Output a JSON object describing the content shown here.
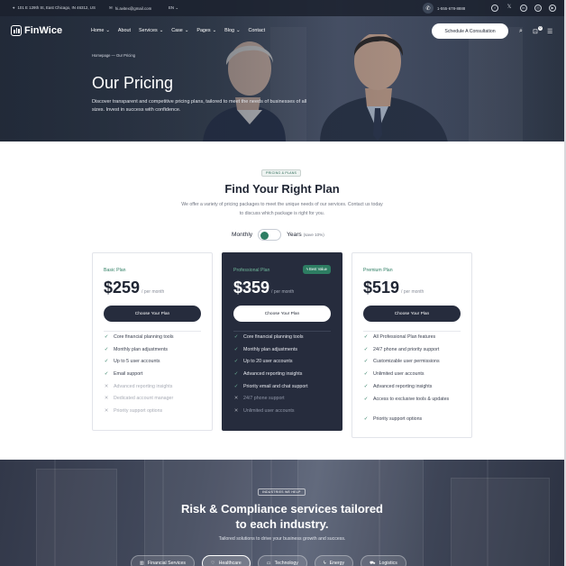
{
  "topbar": {
    "address": "101 E 129th St, East Chicago, IN 46312, US",
    "email": "hi.avitex@gmail.com",
    "language": "EN",
    "phone": "1-555-678-8888"
  },
  "nav": {
    "logo": "FinWice",
    "items": [
      {
        "label": "Home",
        "dropdown": true
      },
      {
        "label": "About",
        "dropdown": false
      },
      {
        "label": "Services",
        "dropdown": true
      },
      {
        "label": "Case",
        "dropdown": true
      },
      {
        "label": "Pages",
        "dropdown": true
      },
      {
        "label": "Blog",
        "dropdown": true
      },
      {
        "label": "Contact",
        "dropdown": false
      }
    ],
    "cta": "Schedule A Consultation",
    "cart_count": "0"
  },
  "hero": {
    "breadcrumb_home": "Homepage",
    "breadcrumb_current": "Our Pricing",
    "title": "Our Pricing",
    "subtitle": "Discover transparent and competitive pricing plans, tailored to meet the needs of businesses of all sizes. Invest in success with confidence."
  },
  "pricing": {
    "tag": "PRICING & PLANS",
    "title": "Find Your Right Plan",
    "description": "We offer a variety of pricing packages to meet the unique needs of our services. Contact us today to discuss which package is right for you.",
    "toggle_monthly": "Monthly",
    "toggle_yearly": "Years",
    "toggle_save": "(save 10%)",
    "plans": [
      {
        "name": "Basic Plan",
        "price": "$259",
        "period": "/ per month",
        "button": "Choose Your Plan",
        "features": [
          {
            "text": "Core financial planning tools",
            "included": true
          },
          {
            "text": "Monthly plan adjustments",
            "included": true
          },
          {
            "text": "Up to 5 user accounts",
            "included": true
          },
          {
            "text": "Email support",
            "included": true
          },
          {
            "text": "Advanced reporting insights",
            "included": false
          },
          {
            "text": "Dedicated account manager",
            "included": false
          },
          {
            "text": "Priority support options",
            "included": false
          }
        ]
      },
      {
        "name": "Professional Plan",
        "badge": "Best Value",
        "price": "$359",
        "period": "/ per month",
        "button": "Choose Your Plan",
        "features": [
          {
            "text": "Core financial planning tools",
            "included": true
          },
          {
            "text": "Monthly plan adjustments",
            "included": true
          },
          {
            "text": "Up to 20 user accounts",
            "included": true
          },
          {
            "text": "Advanced reporting insights",
            "included": true
          },
          {
            "text": "Priority email and chat support",
            "included": true
          },
          {
            "text": "24/7 phone support",
            "included": false
          },
          {
            "text": "Unlimited user accounts",
            "included": false
          }
        ]
      },
      {
        "name": "Premium Plan",
        "price": "$519",
        "period": "/ per month",
        "button": "Choose Your Plan",
        "features": [
          {
            "text": "All Professional Plan features",
            "included": true
          },
          {
            "text": "24/7 phone and priority support",
            "included": true
          },
          {
            "text": "Customizable user permissions",
            "included": true
          },
          {
            "text": "Unlimited user accounts",
            "included": true
          },
          {
            "text": "Advanced reporting insights",
            "included": true
          },
          {
            "text": "Access to exclusive tools & updates",
            "included": true
          },
          {
            "text": "Priority support options",
            "included": true
          }
        ]
      }
    ]
  },
  "industries": {
    "tag": "INDUSTRIES WE HELP",
    "title_line1": "Risk & Compliance services tailored",
    "title_line2": "to each industry.",
    "subtitle": "Tailored solutions to drive your business growth and success.",
    "pills": [
      {
        "label": "Financial Services",
        "icon": "building-icon"
      },
      {
        "label": "Healthcare",
        "icon": "heart-icon",
        "active": true
      },
      {
        "label": "Technology",
        "icon": "monitor-icon"
      },
      {
        "label": "Energy",
        "icon": "bolt-icon"
      },
      {
        "label": "Logistics",
        "icon": "truck-icon"
      }
    ]
  },
  "colors": {
    "accent_green": "#2d7d62",
    "dark_navy": "#262c3d"
  }
}
